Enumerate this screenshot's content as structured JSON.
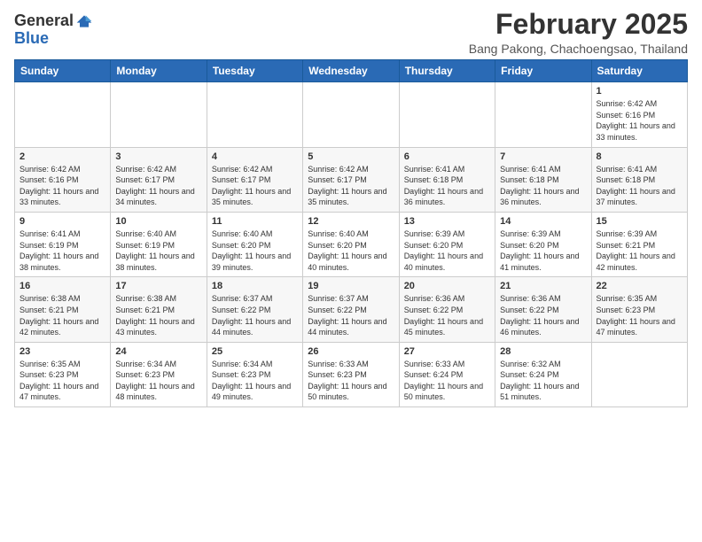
{
  "logo": {
    "general": "General",
    "blue": "Blue"
  },
  "title": {
    "month_year": "February 2025",
    "location": "Bang Pakong, Chachoengsao, Thailand"
  },
  "weekdays": [
    "Sunday",
    "Monday",
    "Tuesday",
    "Wednesday",
    "Thursday",
    "Friday",
    "Saturday"
  ],
  "weeks": [
    [
      {
        "day": "",
        "sunrise": "",
        "sunset": "",
        "daylight": ""
      },
      {
        "day": "",
        "sunrise": "",
        "sunset": "",
        "daylight": ""
      },
      {
        "day": "",
        "sunrise": "",
        "sunset": "",
        "daylight": ""
      },
      {
        "day": "",
        "sunrise": "",
        "sunset": "",
        "daylight": ""
      },
      {
        "day": "",
        "sunrise": "",
        "sunset": "",
        "daylight": ""
      },
      {
        "day": "",
        "sunrise": "",
        "sunset": "",
        "daylight": ""
      },
      {
        "day": "1",
        "sunrise": "Sunrise: 6:42 AM",
        "sunset": "Sunset: 6:16 PM",
        "daylight": "Daylight: 11 hours and 33 minutes."
      }
    ],
    [
      {
        "day": "2",
        "sunrise": "Sunrise: 6:42 AM",
        "sunset": "Sunset: 6:16 PM",
        "daylight": "Daylight: 11 hours and 33 minutes."
      },
      {
        "day": "3",
        "sunrise": "Sunrise: 6:42 AM",
        "sunset": "Sunset: 6:17 PM",
        "daylight": "Daylight: 11 hours and 34 minutes."
      },
      {
        "day": "4",
        "sunrise": "Sunrise: 6:42 AM",
        "sunset": "Sunset: 6:17 PM",
        "daylight": "Daylight: 11 hours and 35 minutes."
      },
      {
        "day": "5",
        "sunrise": "Sunrise: 6:42 AM",
        "sunset": "Sunset: 6:17 PM",
        "daylight": "Daylight: 11 hours and 35 minutes."
      },
      {
        "day": "6",
        "sunrise": "Sunrise: 6:41 AM",
        "sunset": "Sunset: 6:18 PM",
        "daylight": "Daylight: 11 hours and 36 minutes."
      },
      {
        "day": "7",
        "sunrise": "Sunrise: 6:41 AM",
        "sunset": "Sunset: 6:18 PM",
        "daylight": "Daylight: 11 hours and 36 minutes."
      },
      {
        "day": "8",
        "sunrise": "Sunrise: 6:41 AM",
        "sunset": "Sunset: 6:18 PM",
        "daylight": "Daylight: 11 hours and 37 minutes."
      }
    ],
    [
      {
        "day": "9",
        "sunrise": "Sunrise: 6:41 AM",
        "sunset": "Sunset: 6:19 PM",
        "daylight": "Daylight: 11 hours and 38 minutes."
      },
      {
        "day": "10",
        "sunrise": "Sunrise: 6:40 AM",
        "sunset": "Sunset: 6:19 PM",
        "daylight": "Daylight: 11 hours and 38 minutes."
      },
      {
        "day": "11",
        "sunrise": "Sunrise: 6:40 AM",
        "sunset": "Sunset: 6:20 PM",
        "daylight": "Daylight: 11 hours and 39 minutes."
      },
      {
        "day": "12",
        "sunrise": "Sunrise: 6:40 AM",
        "sunset": "Sunset: 6:20 PM",
        "daylight": "Daylight: 11 hours and 40 minutes."
      },
      {
        "day": "13",
        "sunrise": "Sunrise: 6:39 AM",
        "sunset": "Sunset: 6:20 PM",
        "daylight": "Daylight: 11 hours and 40 minutes."
      },
      {
        "day": "14",
        "sunrise": "Sunrise: 6:39 AM",
        "sunset": "Sunset: 6:20 PM",
        "daylight": "Daylight: 11 hours and 41 minutes."
      },
      {
        "day": "15",
        "sunrise": "Sunrise: 6:39 AM",
        "sunset": "Sunset: 6:21 PM",
        "daylight": "Daylight: 11 hours and 42 minutes."
      }
    ],
    [
      {
        "day": "16",
        "sunrise": "Sunrise: 6:38 AM",
        "sunset": "Sunset: 6:21 PM",
        "daylight": "Daylight: 11 hours and 42 minutes."
      },
      {
        "day": "17",
        "sunrise": "Sunrise: 6:38 AM",
        "sunset": "Sunset: 6:21 PM",
        "daylight": "Daylight: 11 hours and 43 minutes."
      },
      {
        "day": "18",
        "sunrise": "Sunrise: 6:37 AM",
        "sunset": "Sunset: 6:22 PM",
        "daylight": "Daylight: 11 hours and 44 minutes."
      },
      {
        "day": "19",
        "sunrise": "Sunrise: 6:37 AM",
        "sunset": "Sunset: 6:22 PM",
        "daylight": "Daylight: 11 hours and 44 minutes."
      },
      {
        "day": "20",
        "sunrise": "Sunrise: 6:36 AM",
        "sunset": "Sunset: 6:22 PM",
        "daylight": "Daylight: 11 hours and 45 minutes."
      },
      {
        "day": "21",
        "sunrise": "Sunrise: 6:36 AM",
        "sunset": "Sunset: 6:22 PM",
        "daylight": "Daylight: 11 hours and 46 minutes."
      },
      {
        "day": "22",
        "sunrise": "Sunrise: 6:35 AM",
        "sunset": "Sunset: 6:23 PM",
        "daylight": "Daylight: 11 hours and 47 minutes."
      }
    ],
    [
      {
        "day": "23",
        "sunrise": "Sunrise: 6:35 AM",
        "sunset": "Sunset: 6:23 PM",
        "daylight": "Daylight: 11 hours and 47 minutes."
      },
      {
        "day": "24",
        "sunrise": "Sunrise: 6:34 AM",
        "sunset": "Sunset: 6:23 PM",
        "daylight": "Daylight: 11 hours and 48 minutes."
      },
      {
        "day": "25",
        "sunrise": "Sunrise: 6:34 AM",
        "sunset": "Sunset: 6:23 PM",
        "daylight": "Daylight: 11 hours and 49 minutes."
      },
      {
        "day": "26",
        "sunrise": "Sunrise: 6:33 AM",
        "sunset": "Sunset: 6:23 PM",
        "daylight": "Daylight: 11 hours and 50 minutes."
      },
      {
        "day": "27",
        "sunrise": "Sunrise: 6:33 AM",
        "sunset": "Sunset: 6:24 PM",
        "daylight": "Daylight: 11 hours and 50 minutes."
      },
      {
        "day": "28",
        "sunrise": "Sunrise: 6:32 AM",
        "sunset": "Sunset: 6:24 PM",
        "daylight": "Daylight: 11 hours and 51 minutes."
      },
      {
        "day": "",
        "sunrise": "",
        "sunset": "",
        "daylight": ""
      }
    ]
  ]
}
